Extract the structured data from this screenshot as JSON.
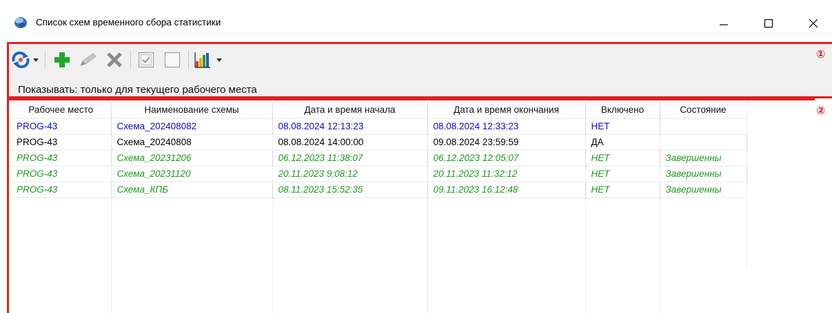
{
  "window": {
    "title": "Список схем временного сбора статистики",
    "minimize_icon": "minimize-icon",
    "maximize_icon": "maximize-icon",
    "close_icon": "close-icon"
  },
  "markers": {
    "toolbar": "①",
    "grid": "②"
  },
  "toolbar": {
    "buttons": [
      {
        "name": "refresh-button",
        "icon": "refresh-icon",
        "has_dropdown": true
      },
      {
        "name": "add-button",
        "icon": "plus-icon"
      },
      {
        "name": "edit-button",
        "icon": "pencil-icon",
        "disabled": true
      },
      {
        "name": "delete-button",
        "icon": "x-icon",
        "disabled": true
      },
      {
        "name": "enable-button",
        "icon": "checkbox-checked-icon",
        "disabled": true
      },
      {
        "name": "disable-button",
        "icon": "checkbox-empty-icon",
        "disabled": true
      },
      {
        "name": "statistics-button",
        "icon": "bar-chart-icon",
        "has_dropdown": true
      }
    ],
    "filter_label": "Показывать: только для текущего рабочего места"
  },
  "grid": {
    "columns": [
      "Рабочее место",
      "Наименование схемы",
      "Дата и время начала",
      "Дата и время окончания",
      "Включено",
      "Состояние"
    ],
    "rows": [
      {
        "style": "blue",
        "cells": [
          "PROG-43",
          "Схема_202408082",
          "08.08.2024 12:13:23",
          "08.08.2024 12:33:23",
          "НЕТ",
          ""
        ]
      },
      {
        "style": "black",
        "cells": [
          "PROG-43",
          "Схема_20240808",
          "08.08.2024 14:00:00",
          "09.08.2024 23:59:59",
          "ДА",
          ""
        ]
      },
      {
        "style": "green",
        "cells": [
          "PROG-43",
          "Схема_20231206",
          "06.12.2023 11:38:07",
          "06.12.2023 12:05:07",
          "НЕТ",
          "Завершенны"
        ]
      },
      {
        "style": "green",
        "cells": [
          "PROG-43",
          "Схема_20231120",
          "20.11.2023 9:08:12",
          "20.11.2023 11:32:12",
          "НЕТ",
          "Завершенны"
        ]
      },
      {
        "style": "green",
        "cells": [
          "PROG-43",
          "Схема_КПБ",
          "08.11.2023 15:52:35",
          "09.11.2023 16:12:48",
          "НЕТ",
          "Завершенны"
        ]
      }
    ]
  },
  "colors": {
    "highlight_border": "#e02020",
    "row_blue": "#0a0adb",
    "row_green": "#1e9a1e",
    "toolbar_bg": "#f0f0f0"
  }
}
